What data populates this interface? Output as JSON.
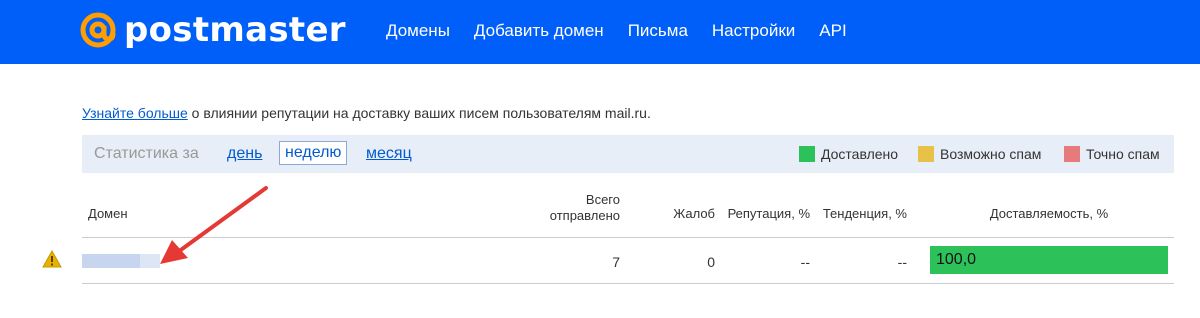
{
  "header": {
    "logo_text": "postmaster",
    "nav": [
      "Домены",
      "Добавить домен",
      "Письма",
      "Настройки",
      "API"
    ]
  },
  "info": {
    "link_text": "Узнайте больше",
    "rest_text": " о влиянии репутации на доставку ваших писем пользователям mail.ru."
  },
  "stats": {
    "label": "Статистика за",
    "periods": [
      "день",
      "неделю",
      "месяц"
    ],
    "selected_period": "неделю",
    "legend": [
      {
        "label": "Доставлено",
        "color": "#2dc15a"
      },
      {
        "label": "Возможно спам",
        "color": "#e8c149"
      },
      {
        "label": "Точно спам",
        "color": "#e77b7b"
      }
    ]
  },
  "table": {
    "headers": {
      "domain": "Домен",
      "sent_line1": "Всего",
      "sent_line2": "отправлено",
      "complaints": "Жалоб",
      "reputation": "Репутация, %",
      "trend": "Тенденция, %",
      "deliverability": "Доставляемость, %"
    },
    "rows": [
      {
        "sent": "7",
        "complaints": "0",
        "reputation": "--",
        "trend": "--",
        "deliverability": "100,0",
        "deliverability_pct": 100
      }
    ]
  }
}
